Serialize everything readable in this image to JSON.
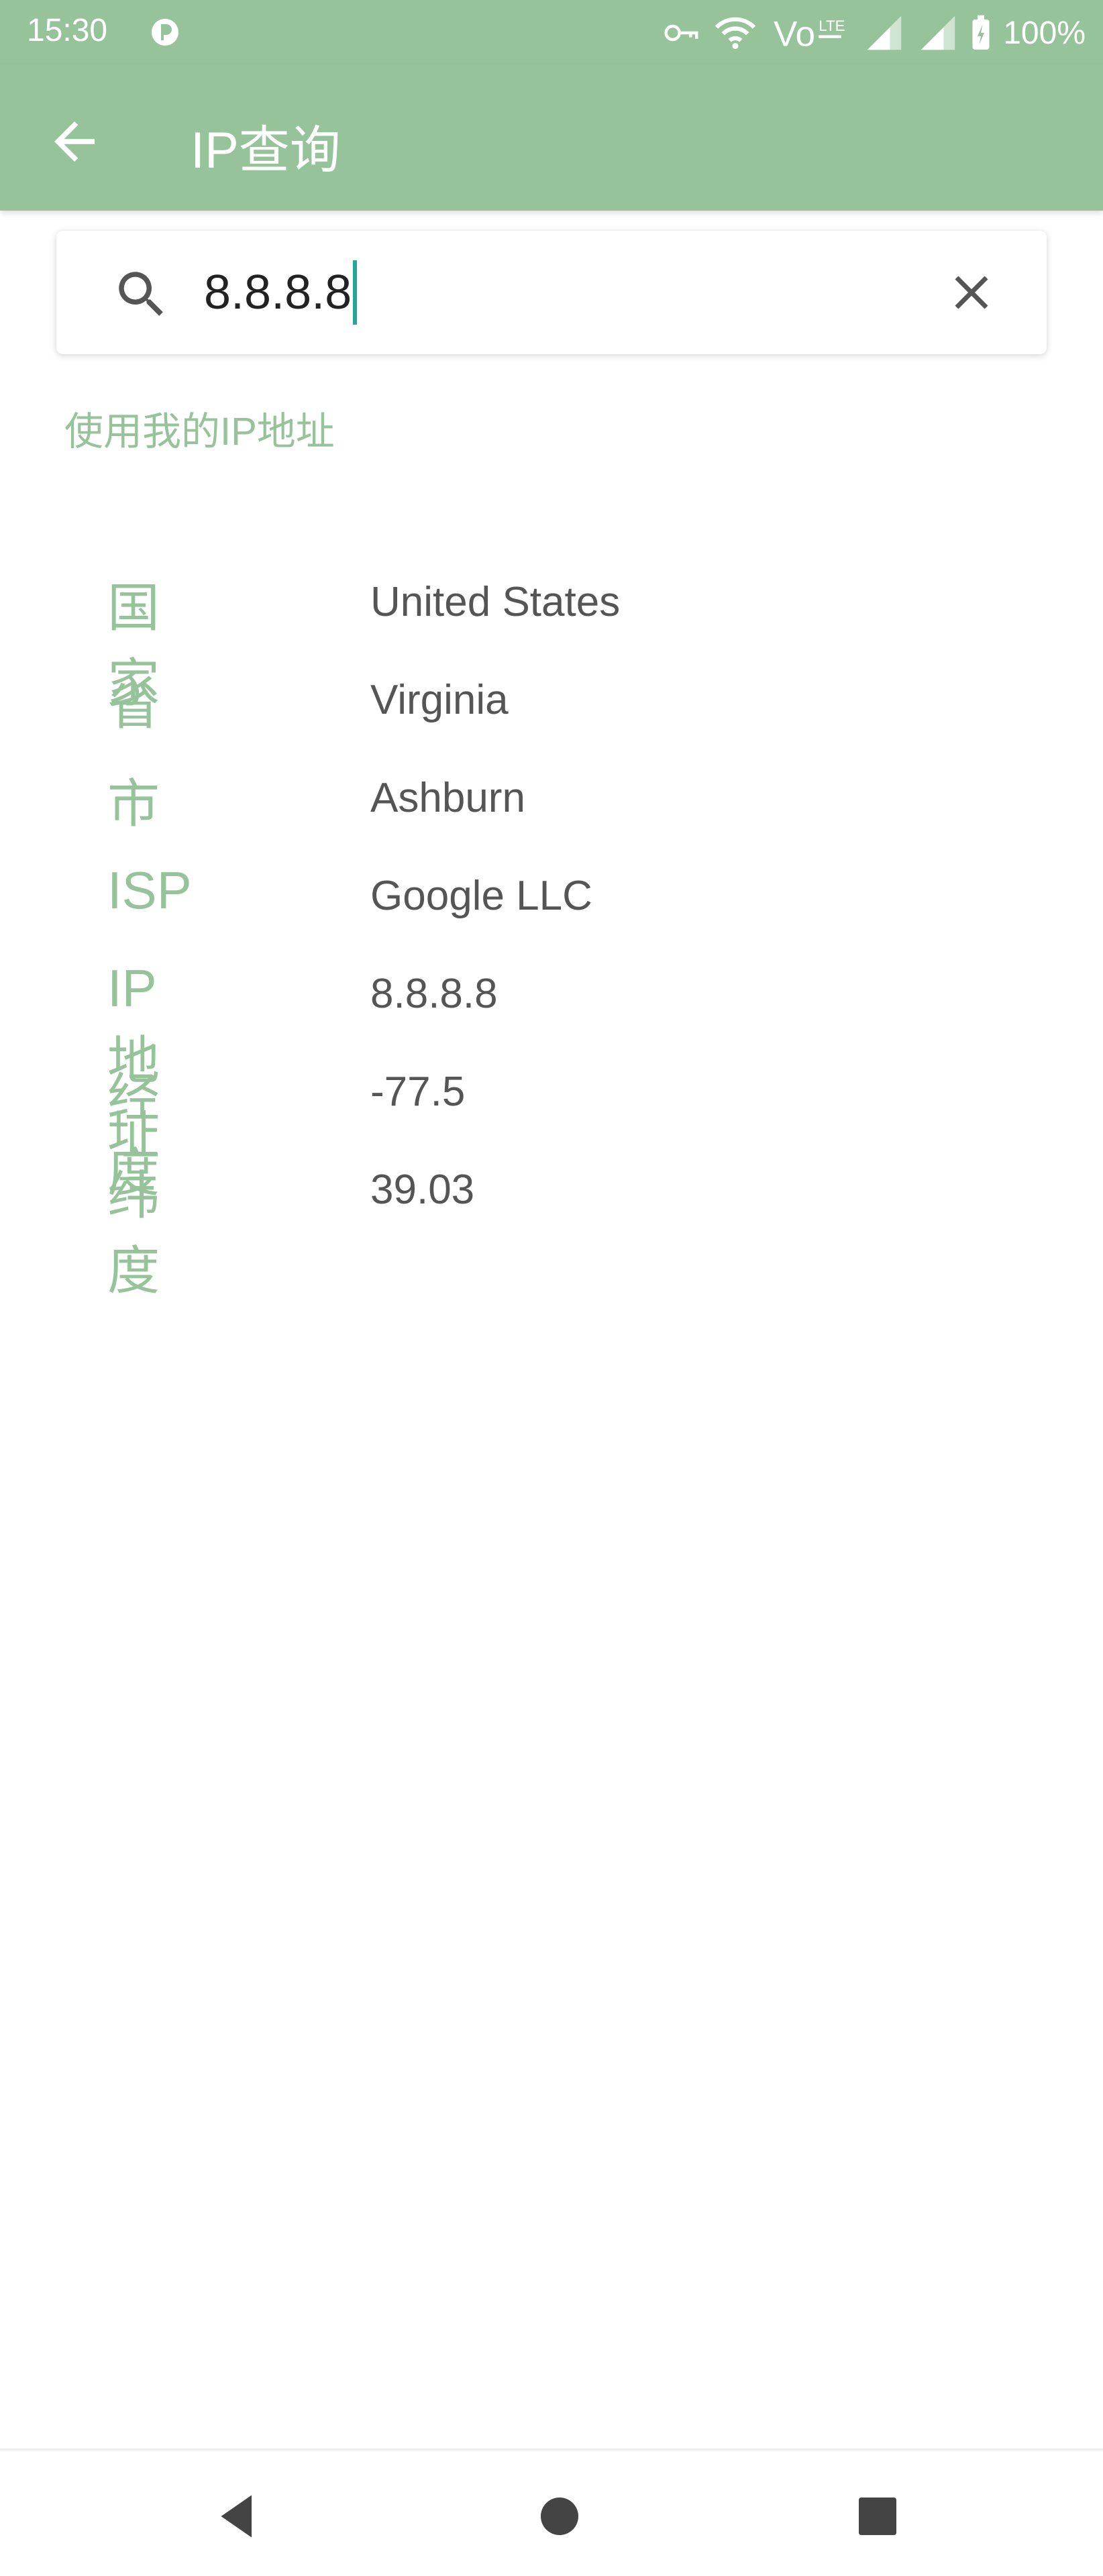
{
  "status_bar": {
    "time": "15:30",
    "battery": "100%",
    "icons": [
      "vpn-key-icon",
      "wifi-icon",
      "volte-icon",
      "signal-icon",
      "signal-icon",
      "battery-icon"
    ]
  },
  "app_bar": {
    "title": "IP查询",
    "back_icon": "arrow-left-icon"
  },
  "search": {
    "value": "8.8.8.8",
    "search_icon": "search-icon",
    "clear_icon": "close-icon"
  },
  "use_my_ip_label": "使用我的IP地址",
  "info": [
    {
      "key": "国家",
      "value": "United States"
    },
    {
      "key": "省",
      "value": "Virginia"
    },
    {
      "key": "市",
      "value": "Ashburn"
    },
    {
      "key": "ISP",
      "value": "Google LLC"
    },
    {
      "key": "IP地址",
      "value": "8.8.8.8"
    },
    {
      "key": "经度",
      "value": "-77.5"
    },
    {
      "key": "纬度",
      "value": "39.03"
    }
  ],
  "nav": {
    "icons": [
      "back-triangle-icon",
      "home-circle-icon",
      "recents-square-icon"
    ]
  },
  "colors": {
    "accent": "#96c39a",
    "caret": "#26a69a",
    "value_text": "#555555"
  }
}
